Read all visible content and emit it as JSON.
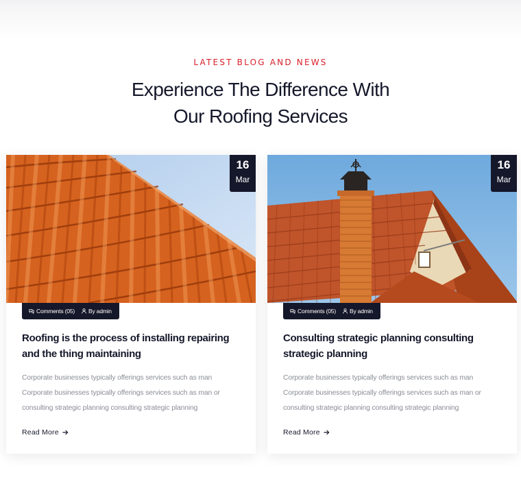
{
  "section": {
    "eyebrow": "LATEST BLOG AND NEWS",
    "title_line1": "Experience The Difference With",
    "title_line2": "Our Roofing Services"
  },
  "posts": [
    {
      "date_day": "16",
      "date_month": "Mar",
      "comments": "Comments (05)",
      "author": "By admin",
      "title": "Roofing is the process of installing repairing and the thing maintaining",
      "excerpt": "Corporate businesses typically offerings services such as man Corporate businesses typically offerings services such as man or consulting strategic planning consulting strategic planning",
      "read_more": "Read More",
      "image": "orange-roof-tiles-photo"
    },
    {
      "date_day": "16",
      "date_month": "Mar",
      "comments": "Comments (05)",
      "author": "By admin",
      "title": "Consulting strategic planning consulting strategic planning",
      "excerpt": "Corporate businesses typically offerings services such as man Corporate businesses typically offerings services such as man or consulting strategic planning consulting strategic planning",
      "read_more": "Read More",
      "image": "brick-chimney-roof-photo"
    }
  ],
  "icons": {
    "comments": "comments-icon",
    "author": "user-icon",
    "arrow": "arrow-right-icon"
  },
  "colors": {
    "accent": "#d8202a",
    "dark": "#15172a",
    "text_muted": "#8a8d96"
  }
}
